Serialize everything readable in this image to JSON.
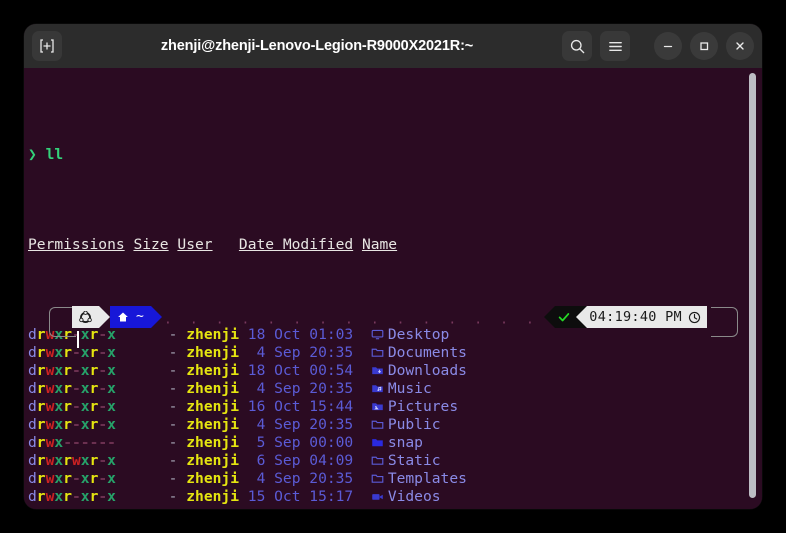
{
  "window": {
    "title": "zhenji@zhenji-Lenovo-Legion-R9000X2021R:~",
    "new_tab_label": "+",
    "search_label": "",
    "menu_label": "",
    "minimize_label": "",
    "maximize_label": "",
    "close_label": ""
  },
  "terminal": {
    "prompt_symbol": "❯",
    "command": "ll",
    "headers": {
      "permissions": "Permissions",
      "size": "Size",
      "user": "User",
      "date_modified": "Date Modified",
      "name": "Name"
    },
    "rows": [
      {
        "perm": "drwxr-xr-x",
        "size": "-",
        "user": "zhenji",
        "date": "18 Oct 01:03",
        "name": "Desktop",
        "icon": "monitor-icon"
      },
      {
        "perm": "drwxr-xr-x",
        "size": "-",
        "user": "zhenji",
        "date": " 4 Sep 20:35",
        "name": "Documents",
        "icon": "folder-open-icon"
      },
      {
        "perm": "drwxr-xr-x",
        "size": "-",
        "user": "zhenji",
        "date": "18 Oct 00:54",
        "name": "Downloads",
        "icon": "folder-download-icon"
      },
      {
        "perm": "drwxr-xr-x",
        "size": "-",
        "user": "zhenji",
        "date": " 4 Sep 20:35",
        "name": "Music",
        "icon": "folder-music-icon"
      },
      {
        "perm": "drwxr-xr-x",
        "size": "-",
        "user": "zhenji",
        "date": "16 Oct 15:44",
        "name": "Pictures",
        "icon": "folder-image-icon"
      },
      {
        "perm": "drwxr-xr-x",
        "size": "-",
        "user": "zhenji",
        "date": " 4 Sep 20:35",
        "name": "Public",
        "icon": "folder-open-icon"
      },
      {
        "perm": "drwx------",
        "size": "-",
        "user": "zhenji",
        "date": " 5 Sep 00:00",
        "name": "snap",
        "icon": "folder-solid-icon"
      },
      {
        "perm": "drwxrwxr-x",
        "size": "-",
        "user": "zhenji",
        "date": " 6 Sep 04:09",
        "name": "Static",
        "icon": "folder-open-icon"
      },
      {
        "perm": "drwxr-xr-x",
        "size": "-",
        "user": "zhenji",
        "date": " 4 Sep 20:35",
        "name": "Templates",
        "icon": "folder-open-icon"
      },
      {
        "perm": "drwxr-xr-x",
        "size": "-",
        "user": "zhenji",
        "date": "15 Oct 15:17",
        "name": "Videos",
        "icon": "folder-video-icon"
      }
    ]
  },
  "prompt": {
    "os_icon": "ubuntu-icon",
    "home_icon": "home-icon",
    "path": "~",
    "status_icon": "check-icon",
    "time": "04:19:40 PM",
    "clock_icon": "clock-icon",
    "filler_dots": "· · · · · · · · · · · · · · · · · · · · · · · · · · · · · · · · · · · · · · · · ·"
  },
  "colors": {
    "background": "#2b0b22",
    "titlebar": "#2c2c2c",
    "accent_blue": "#1717d8",
    "prompt_green": "#33d17a",
    "segment_light": "#e9e9e9"
  }
}
